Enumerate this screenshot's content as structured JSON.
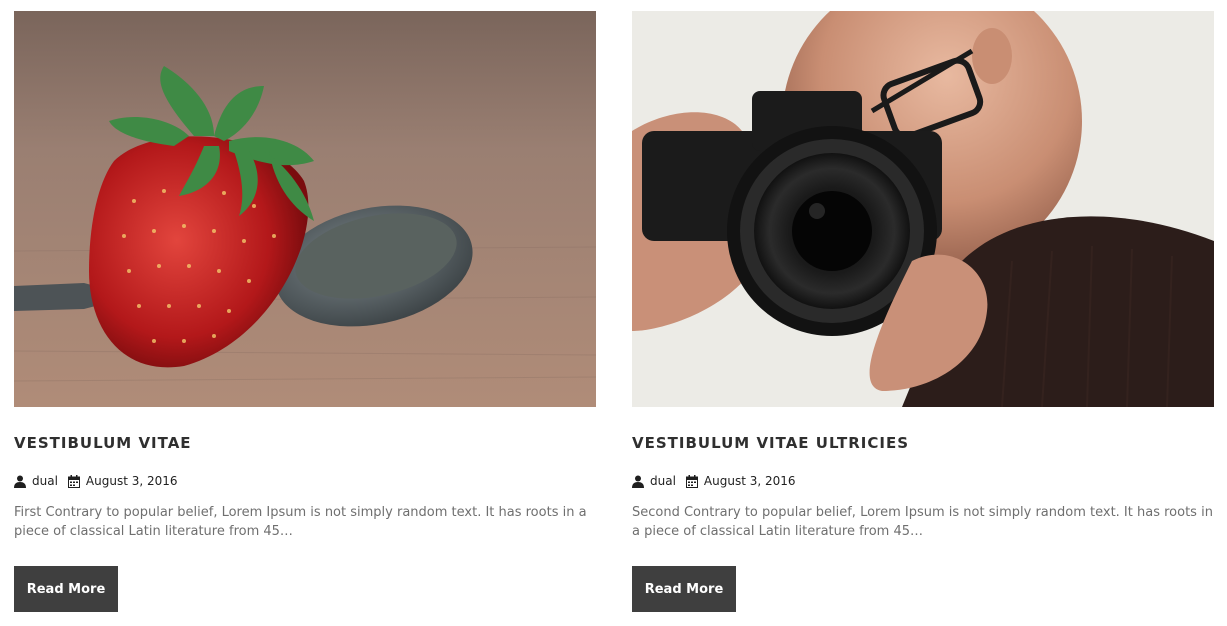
{
  "posts": [
    {
      "title": "VESTIBULUM VITAE",
      "author": "dual",
      "date": "August 3, 2016",
      "excerpt": "First Contrary to popular belief, Lorem Ipsum is not simply random text. It has roots in a piece of classical Latin literature from 45…",
      "button": "Read More",
      "image": "strawberry-and-spoon-photo",
      "author_icon": "user-icon",
      "date_icon": "calendar-icon"
    },
    {
      "title": "VESTIBULUM VITAE ULTRICIES",
      "author": "dual",
      "date": "August 3, 2016",
      "excerpt": "Second Contrary to popular belief, Lorem Ipsum is not simply random text. It has roots in a piece of classical Latin literature from 45…",
      "button": "Read More",
      "image": "photographer-with-camera-photo",
      "author_icon": "user-icon",
      "date_icon": "calendar-icon"
    }
  ],
  "colors": {
    "button_bg": "#3f3f3f",
    "title": "#2f2f2f",
    "excerpt": "#6f6f6f"
  }
}
